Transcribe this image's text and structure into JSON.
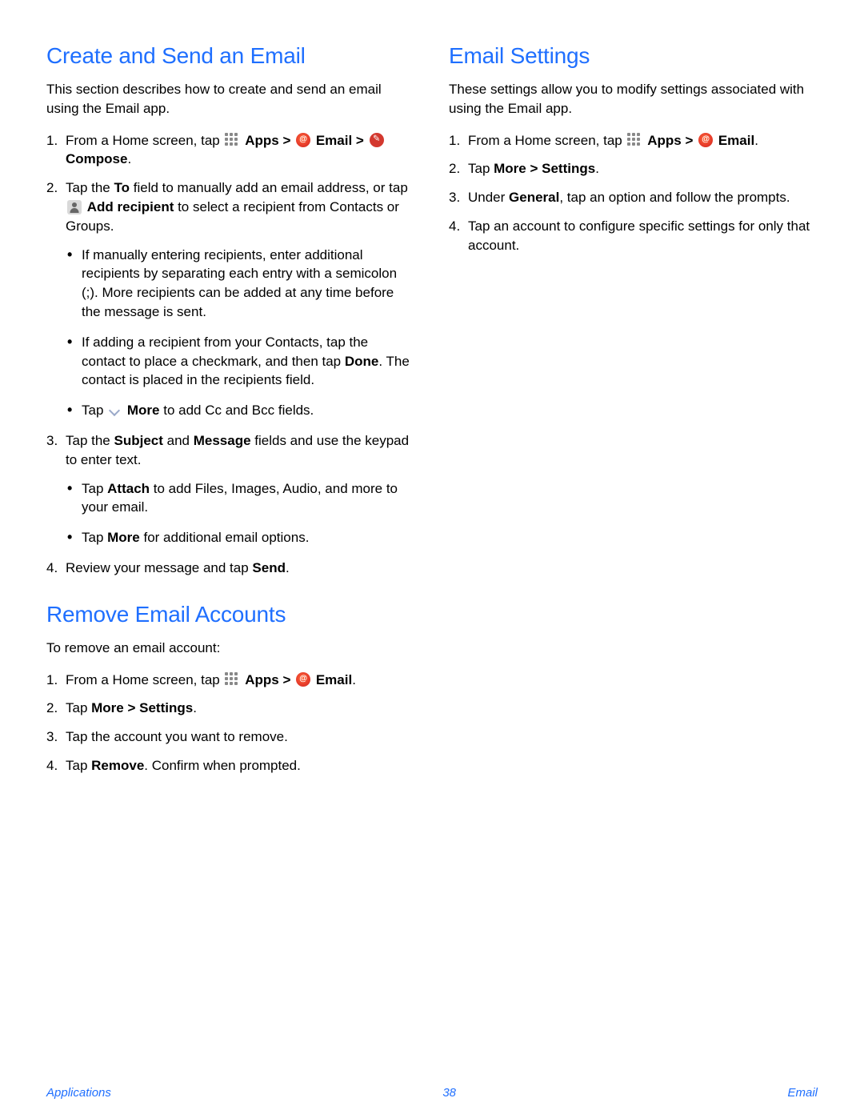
{
  "left": {
    "section1": {
      "heading": "Create and Send an Email",
      "intro": "This section describes how to create and send an email using the Email app.",
      "step1_pre": "From a Home screen, tap ",
      "apps": "Apps",
      "gt": " > ",
      "email": "Email",
      "compose": "Compose",
      "step2_a": "Tap the ",
      "step2_to": "To",
      "step2_b": " field to manually add an email address, or tap ",
      "step2_addrec": "Add recipient",
      "step2_c": " to select a recipient from Contacts or Groups.",
      "bullet2a": "If manually entering recipients, enter additional recipients by separating each entry with a semicolon (;). More recipients can be added at any time before the message is sent.",
      "bullet2b_a": "If adding a recipient from your Contacts, tap the contact to place a checkmark, and then tap ",
      "bullet2b_done": "Done",
      "bullet2b_b": ". The contact is placed in the recipients field.",
      "bullet2c_a": "Tap ",
      "bullet2c_more": "More",
      "bullet2c_b": " to add Cc and Bcc fields.",
      "step3_a": "Tap the ",
      "step3_subject": "Subject",
      "step3_and": " and ",
      "step3_message": "Message",
      "step3_b": " fields and use the keypad to enter text.",
      "bullet3a_a": "Tap ",
      "bullet3a_attach": "Attach",
      "bullet3a_b": " to add Files, Images, Audio, and more to your email.",
      "bullet3b_a": "Tap ",
      "bullet3b_more": "More",
      "bullet3b_b": " for additional email options.",
      "step4_a": "Review your message and tap ",
      "step4_send": "Send",
      "step4_b": "."
    },
    "section2": {
      "heading": "Remove Email Accounts",
      "intro": "To remove an email account:",
      "step1_pre": "From a Home screen, tap ",
      "apps": "Apps",
      "gt": " > ",
      "email": "Email",
      "dot": ".",
      "step2_a": "Tap ",
      "step2_more": "More",
      "step2_gt": " > ",
      "step2_settings": "Settings",
      "step2_b": ".",
      "step3": "Tap the account you want to remove.",
      "step4_a": "Tap ",
      "step4_remove": "Remove",
      "step4_b": ". Confirm when prompted."
    }
  },
  "right": {
    "section1": {
      "heading": "Email Settings",
      "intro": "These settings allow you to modify settings associated with using the Email app.",
      "step1_pre": "From a Home screen, tap ",
      "apps": "Apps",
      "gt": " > ",
      "email": "Email",
      "dot": ".",
      "step2_a": "Tap ",
      "step2_more": "More",
      "step2_gt": " > ",
      "step2_settings": "Settings",
      "step2_b": ".",
      "step3_a": "Under ",
      "step3_general": "General",
      "step3_b": ", tap an option and follow the prompts.",
      "step4": "Tap an account to configure specific settings for only that account."
    }
  },
  "footer": {
    "left": "Applications",
    "center": "38",
    "right": "Email"
  }
}
